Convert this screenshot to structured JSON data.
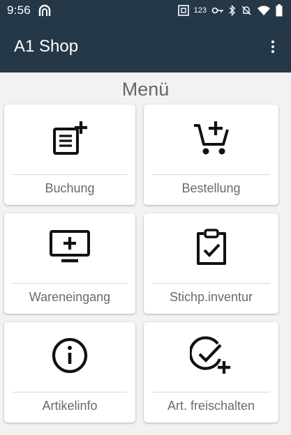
{
  "status": {
    "time": "9:56",
    "icons": [
      "app-arch-icon",
      "nfc-icon",
      "numeric-123-icon",
      "key-icon",
      "bluetooth-icon",
      "mute-icon",
      "wifi-icon",
      "battery-icon"
    ],
    "numeric_label": "123"
  },
  "appbar": {
    "title": "A1 Shop",
    "overflow_icon": "more-vert-icon"
  },
  "heading": "Menü",
  "tiles": [
    {
      "label": "Buchung",
      "icon": "note-add-icon"
    },
    {
      "label": "Bestellung",
      "icon": "cart-add-icon"
    },
    {
      "label": "Wareneingang",
      "icon": "monitor-add-icon"
    },
    {
      "label": "Stichp.inventur",
      "icon": "clipboard-check-icon"
    },
    {
      "label": "Artikelinfo",
      "icon": "info-icon"
    },
    {
      "label": "Art. freischalten",
      "icon": "check-add-icon"
    }
  ],
  "colors": {
    "appbar": "#253848",
    "background": "#f2f2f2",
    "tile": "#ffffff",
    "label": "#6a6a6a"
  }
}
